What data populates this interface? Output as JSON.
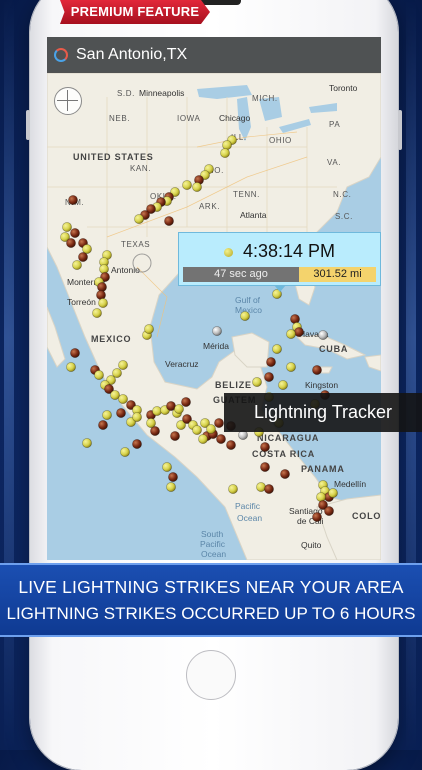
{
  "banner": {
    "label": "PREMIUM FEATURE"
  },
  "topbar": {
    "location": "San Antonio,TX"
  },
  "popup": {
    "time": "4:38:14 PM",
    "ago": "47 sec ago",
    "distance": "301.52 mi"
  },
  "overlay": {
    "label": "Lightning Tracker"
  },
  "promo": {
    "line1": "LIVE LIGHTNING STRIKES NEAR YOUR AREA",
    "line2": "LIGHTNING STRIKES OCCURRED UP TO 6 HOURS"
  },
  "map_labels": [
    {
      "text": "S.D.",
      "kind": "state"
    },
    {
      "text": "Minneapolis",
      "kind": "city"
    },
    {
      "text": "MICH.",
      "kind": "state"
    },
    {
      "text": "Toronto",
      "kind": "city"
    },
    {
      "text": "NEB.",
      "kind": "state"
    },
    {
      "text": "IOWA",
      "kind": "state"
    },
    {
      "text": "Chicago",
      "kind": "city"
    },
    {
      "text": "PA",
      "kind": "state"
    },
    {
      "text": "UNITED STATES",
      "kind": "country"
    },
    {
      "text": "ILL.",
      "kind": "state"
    },
    {
      "text": "OHIO",
      "kind": "state"
    },
    {
      "text": "KAN.",
      "kind": "state"
    },
    {
      "text": "MO.",
      "kind": "state"
    },
    {
      "text": "VA.",
      "kind": "state"
    },
    {
      "text": "N.M.",
      "kind": "state"
    },
    {
      "text": "OKLA.",
      "kind": "state"
    },
    {
      "text": "TENN.",
      "kind": "state"
    },
    {
      "text": "N.C.",
      "kind": "state"
    },
    {
      "text": "ARK.",
      "kind": "state"
    },
    {
      "text": "S.C.",
      "kind": "state"
    },
    {
      "text": "Atlanta",
      "kind": "city"
    },
    {
      "text": "TEXAS",
      "kind": "state"
    },
    {
      "text": "Antonio",
      "kind": "city"
    },
    {
      "text": "Torreón",
      "kind": "city"
    },
    {
      "text": "MEXICO",
      "kind": "country"
    },
    {
      "text": "Gulf of",
      "kind": "water"
    },
    {
      "text": "Mexico",
      "kind": "water"
    },
    {
      "text": "Mérida",
      "kind": "city"
    },
    {
      "text": "Havana",
      "kind": "city"
    },
    {
      "text": "CUBA",
      "kind": "country"
    },
    {
      "text": "Veracruz",
      "kind": "city"
    },
    {
      "text": "Kingston",
      "kind": "city"
    },
    {
      "text": "BELIZE",
      "kind": "country"
    },
    {
      "text": "GUATEM",
      "kind": "country"
    },
    {
      "text": "NICARAGUA",
      "kind": "country"
    },
    {
      "text": "COSTA RICA",
      "kind": "country"
    },
    {
      "text": "PANAMA",
      "kind": "country"
    },
    {
      "text": "Medellín",
      "kind": "city"
    },
    {
      "text": "South",
      "kind": "water"
    },
    {
      "text": "Pacific",
      "kind": "water"
    },
    {
      "text": "Ocean",
      "kind": "water"
    },
    {
      "text": "Pacific",
      "kind": "water"
    },
    {
      "text": "Ocean",
      "kind": "water"
    },
    {
      "text": "Santiago",
      "kind": "city"
    },
    {
      "text": "de Cali",
      "kind": "city"
    },
    {
      "text": "Quito",
      "kind": "city"
    },
    {
      "text": "COLOM",
      "kind": "country"
    },
    {
      "text": "Monterrey",
      "kind": "city"
    }
  ],
  "colors": {
    "water": "#a9cde4",
    "land": "#f1eee4",
    "strike_recent": "#d6d24a",
    "strike_old": "#7a2a14",
    "strike_gray": "#bcbcbc",
    "banner": "#c41a2c",
    "promo_strip": "#1646a6"
  }
}
